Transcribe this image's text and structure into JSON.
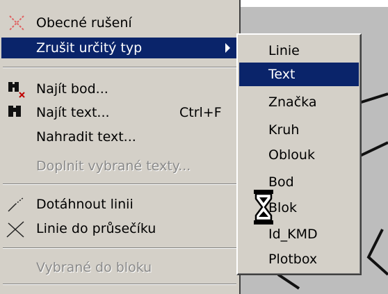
{
  "menu": {
    "items": [
      {
        "label": "Obecné rušení",
        "icon": "cross-cancel-icon"
      },
      {
        "label": "Zrušit určitý typ",
        "highlighted": true,
        "has_submenu": true
      },
      {
        "label": "Najít bod...",
        "icon": "binoculars-point-icon"
      },
      {
        "label": "Najít text...",
        "shortcut": "Ctrl+F",
        "icon": "binoculars-icon"
      },
      {
        "label": "Nahradit text..."
      },
      {
        "label": "Doplnit vybrané texty...",
        "disabled": true
      },
      {
        "label": "Dotáhnout linii",
        "icon": "extend-line-icon"
      },
      {
        "label": "Linie do průsečíku",
        "icon": "intersection-icon"
      },
      {
        "label": "Vybrané do bloku",
        "disabled": true
      }
    ]
  },
  "submenu": {
    "items": [
      {
        "label": "Linie"
      },
      {
        "label": "Text",
        "highlighted": true
      },
      {
        "label": "Značka"
      },
      {
        "label": "Kruh"
      },
      {
        "label": "Oblouk"
      },
      {
        "label": "Bod"
      },
      {
        "label": "Blok"
      },
      {
        "label": "Id_KMD"
      },
      {
        "label": "Plotbox"
      }
    ]
  },
  "colors": {
    "highlight": "#0a246a",
    "menu_bg": "#d4d0c8",
    "disabled_text": "#8a8a8a"
  },
  "cursor": "hourglass-cursor-icon"
}
